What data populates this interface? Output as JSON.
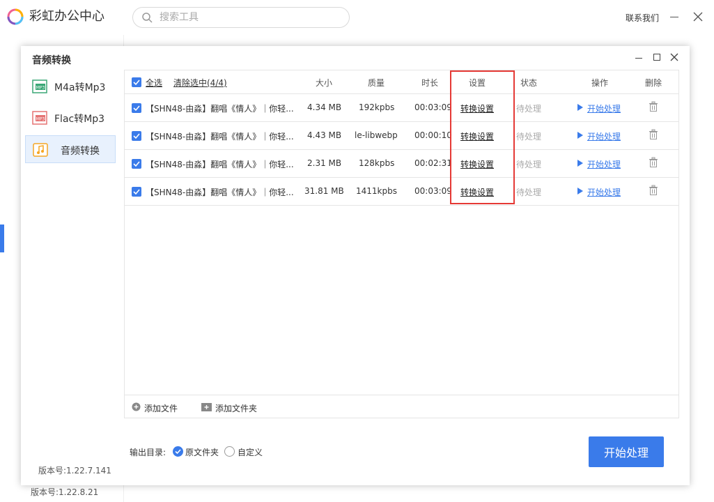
{
  "app": {
    "title": "彩虹办公中心",
    "search_placeholder": "搜索工具",
    "contact": "联系我们",
    "version": "版本号:1.22.8.21"
  },
  "dialog": {
    "title": "音频转换",
    "version": "版本号:1.22.7.141",
    "sidebar": [
      {
        "label": "M4a转Mp3",
        "icon": "mp3-file-icon"
      },
      {
        "label": "Flac转Mp3",
        "icon": "mp3-file-icon"
      },
      {
        "label": "音频转换",
        "icon": "music-note-icon"
      }
    ],
    "table": {
      "select_all": "全选",
      "clear_selected": "清除选中(4/4)",
      "headers": {
        "size": "大小",
        "quality": "质量",
        "duration": "时长",
        "setting": "设置",
        "status": "状态",
        "action": "操作",
        "delete": "删除"
      },
      "rows": [
        {
          "name": "【SHN48-由淼】翻唱《情人》｜你轻...",
          "size": "4.34 MB",
          "quality": "192kpbs",
          "duration": "00:03:09",
          "setting": "转换设置",
          "status": "待处理",
          "action": "开始处理"
        },
        {
          "name": "【SHN48-由淼】翻唱《情人》｜你轻...",
          "size": "4.43 MB",
          "quality": "le-libwebp",
          "duration": "00:00:10",
          "setting": "转换设置",
          "status": "待处理",
          "action": "开始处理"
        },
        {
          "name": "【SHN48-由淼】翻唱《情人》｜你轻...",
          "size": "2.31 MB",
          "quality": "128kpbs",
          "duration": "00:02:31",
          "setting": "转换设置",
          "status": "待处理",
          "action": "开始处理"
        },
        {
          "name": "【SHN48-由淼】翻唱《情人》｜你轻...",
          "size": "31.81 MB",
          "quality": "1411kpbs",
          "duration": "00:03:09",
          "setting": "转换设置",
          "status": "待处理",
          "action": "开始处理"
        }
      ]
    },
    "footer": {
      "add_file": "添加文件",
      "add_folder": "添加文件夹",
      "output_label": "输出目录:",
      "option_source": "原文件夹",
      "option_custom": "自定义",
      "start_button": "开始处理"
    }
  },
  "colors": {
    "accent": "#3a7bea",
    "highlight": "#e53935"
  }
}
